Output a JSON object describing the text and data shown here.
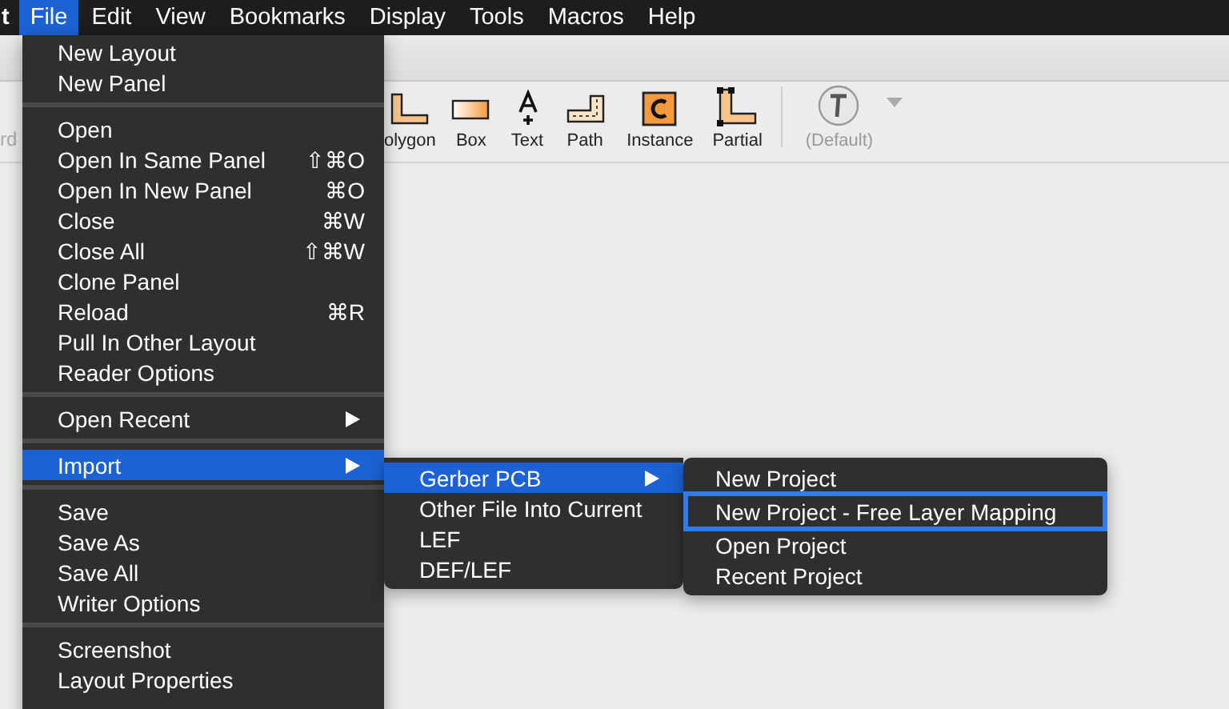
{
  "menu_bar": [
    {
      "label": "t",
      "selected": false
    },
    {
      "label": "File",
      "selected": true
    },
    {
      "label": "Edit",
      "selected": false
    },
    {
      "label": "View",
      "selected": false
    },
    {
      "label": "Bookmarks",
      "selected": false
    },
    {
      "label": "Display",
      "selected": false
    },
    {
      "label": "Tools",
      "selected": false
    },
    {
      "label": "Macros",
      "selected": false
    },
    {
      "label": "Help",
      "selected": false
    }
  ],
  "toolbar": {
    "cut_label": "rd",
    "tools": [
      {
        "kind": "polygon",
        "label": "olygon"
      },
      {
        "kind": "box",
        "label": "Box"
      },
      {
        "kind": "text",
        "label": "Text"
      },
      {
        "kind": "path",
        "label": "Path"
      },
      {
        "kind": "instance",
        "label": "Instance"
      },
      {
        "kind": "partial",
        "label": "Partial"
      },
      {
        "kind": "default",
        "label": "(Default)",
        "disabled": true
      }
    ]
  },
  "file_menu": {
    "sections": [
      [
        {
          "label": "New Layout",
          "selected": false
        },
        {
          "label": "New Panel",
          "selected": false
        }
      ],
      [
        {
          "label": "Open",
          "selected": false
        },
        {
          "label": "Open In Same Panel",
          "shortcut": "⇧⌘O",
          "selected": false
        },
        {
          "label": "Open In New Panel",
          "shortcut": "⌘O",
          "selected": false
        },
        {
          "label": "Close",
          "shortcut": "⌘W",
          "selected": false
        },
        {
          "label": "Close All",
          "shortcut": "⇧⌘W",
          "selected": false
        },
        {
          "label": "Clone Panel",
          "selected": false
        },
        {
          "label": "Reload",
          "shortcut": "⌘R",
          "selected": false
        },
        {
          "label": "Pull In Other Layout",
          "selected": false
        },
        {
          "label": "Reader Options",
          "selected": false
        }
      ],
      [
        {
          "label": "Open Recent",
          "submenu": true,
          "selected": false
        }
      ],
      [
        {
          "label": "Import",
          "submenu": true,
          "selected": true
        }
      ],
      [
        {
          "label": "Save",
          "selected": false
        },
        {
          "label": "Save As",
          "selected": false
        },
        {
          "label": "Save All",
          "selected": false
        },
        {
          "label": "Writer Options",
          "selected": false
        }
      ],
      [
        {
          "label": "Screenshot",
          "selected": false
        },
        {
          "label": "Layout Properties",
          "selected": false
        }
      ]
    ]
  },
  "import_menu": {
    "items": [
      {
        "label": "Gerber PCB",
        "submenu": true,
        "selected": true
      },
      {
        "label": "Other File Into Current",
        "selected": false
      },
      {
        "label": "LEF",
        "selected": false
      },
      {
        "label": "DEF/LEF",
        "selected": false
      }
    ]
  },
  "gerber_menu": {
    "items": [
      {
        "label": "New Project",
        "focused": false
      },
      {
        "label": "New Project - Free Layer Mapping",
        "focused": true
      },
      {
        "label": "Open Project",
        "focused": false
      },
      {
        "label": "Recent Project",
        "focused": false
      }
    ]
  }
}
